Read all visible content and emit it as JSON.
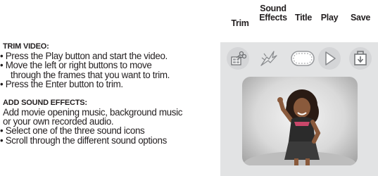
{
  "instructions": {
    "trim": {
      "heading": "TRIM VIDEO:",
      "lines": [
        "Press the Play button and start the video.",
        "Move the left or right buttons to move",
        "through the frames that you want to trim.",
        "Press the Enter button to trim."
      ]
    },
    "sound": {
      "heading": "ADD SOUND EFFECTS:",
      "lines": [
        "Add movie opening music, background music",
        "or your own recorded audio.",
        "Select one of the three sound icons",
        "Scroll through the different sound options"
      ]
    }
  },
  "toolbar": {
    "labels": {
      "trim": "Trim",
      "sound_line1": "Sound",
      "sound_line2": "Effects",
      "title": "Title",
      "play": "Play",
      "save": "Save"
    },
    "icons": [
      "film-scissors-icon",
      "sound-effects-icon",
      "title-icon",
      "play-icon",
      "save-icon"
    ]
  },
  "colors": {
    "panel": "#e2e3e4",
    "icon_bg": "#d4d5d7",
    "icon_stroke": "#8a8c8f",
    "text": "#231f20"
  }
}
